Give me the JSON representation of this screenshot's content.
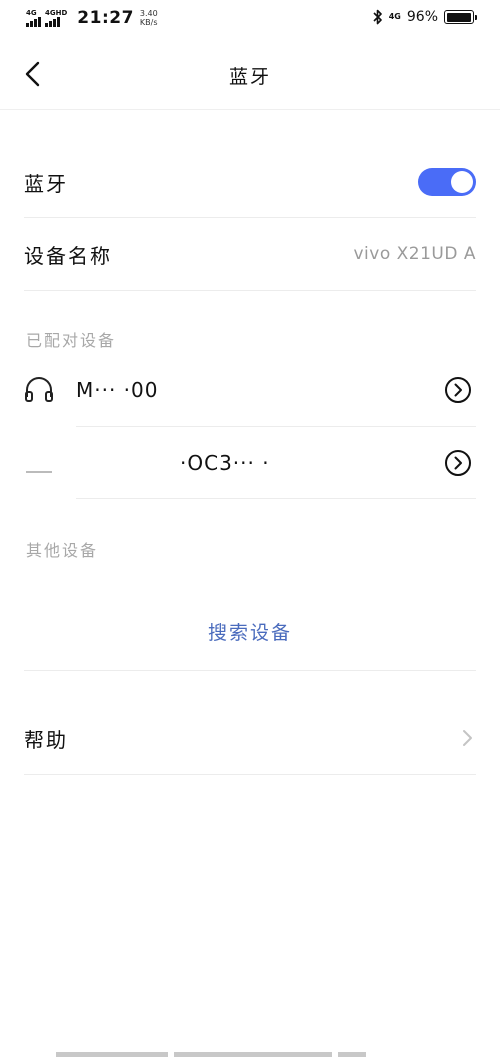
{
  "status_bar": {
    "net1": "4G",
    "net2": "4GHD",
    "time": "21:27",
    "speed_value": "3.40",
    "speed_unit": "KB/s",
    "net_right": "4G",
    "battery_percent": "96%",
    "battery_level": 0.96
  },
  "header": {
    "title": "蓝牙",
    "back_icon": "chevron-left-icon"
  },
  "bluetooth": {
    "label": "蓝牙",
    "enabled": true,
    "accent_color": "#4a6cf7"
  },
  "device_name": {
    "label": "设备名称",
    "value": "vivo X21UD A"
  },
  "paired_devices": {
    "header": "已配对设备",
    "items": [
      {
        "name": "M··· ·00",
        "icon": "headphones-icon"
      },
      {
        "name": "·OC3··· ·",
        "icon": "device-icon"
      }
    ]
  },
  "other_devices": {
    "header": "其他设备",
    "search_label": "搜索设备",
    "link_color": "#4a6bbd"
  },
  "help": {
    "label": "帮助"
  }
}
